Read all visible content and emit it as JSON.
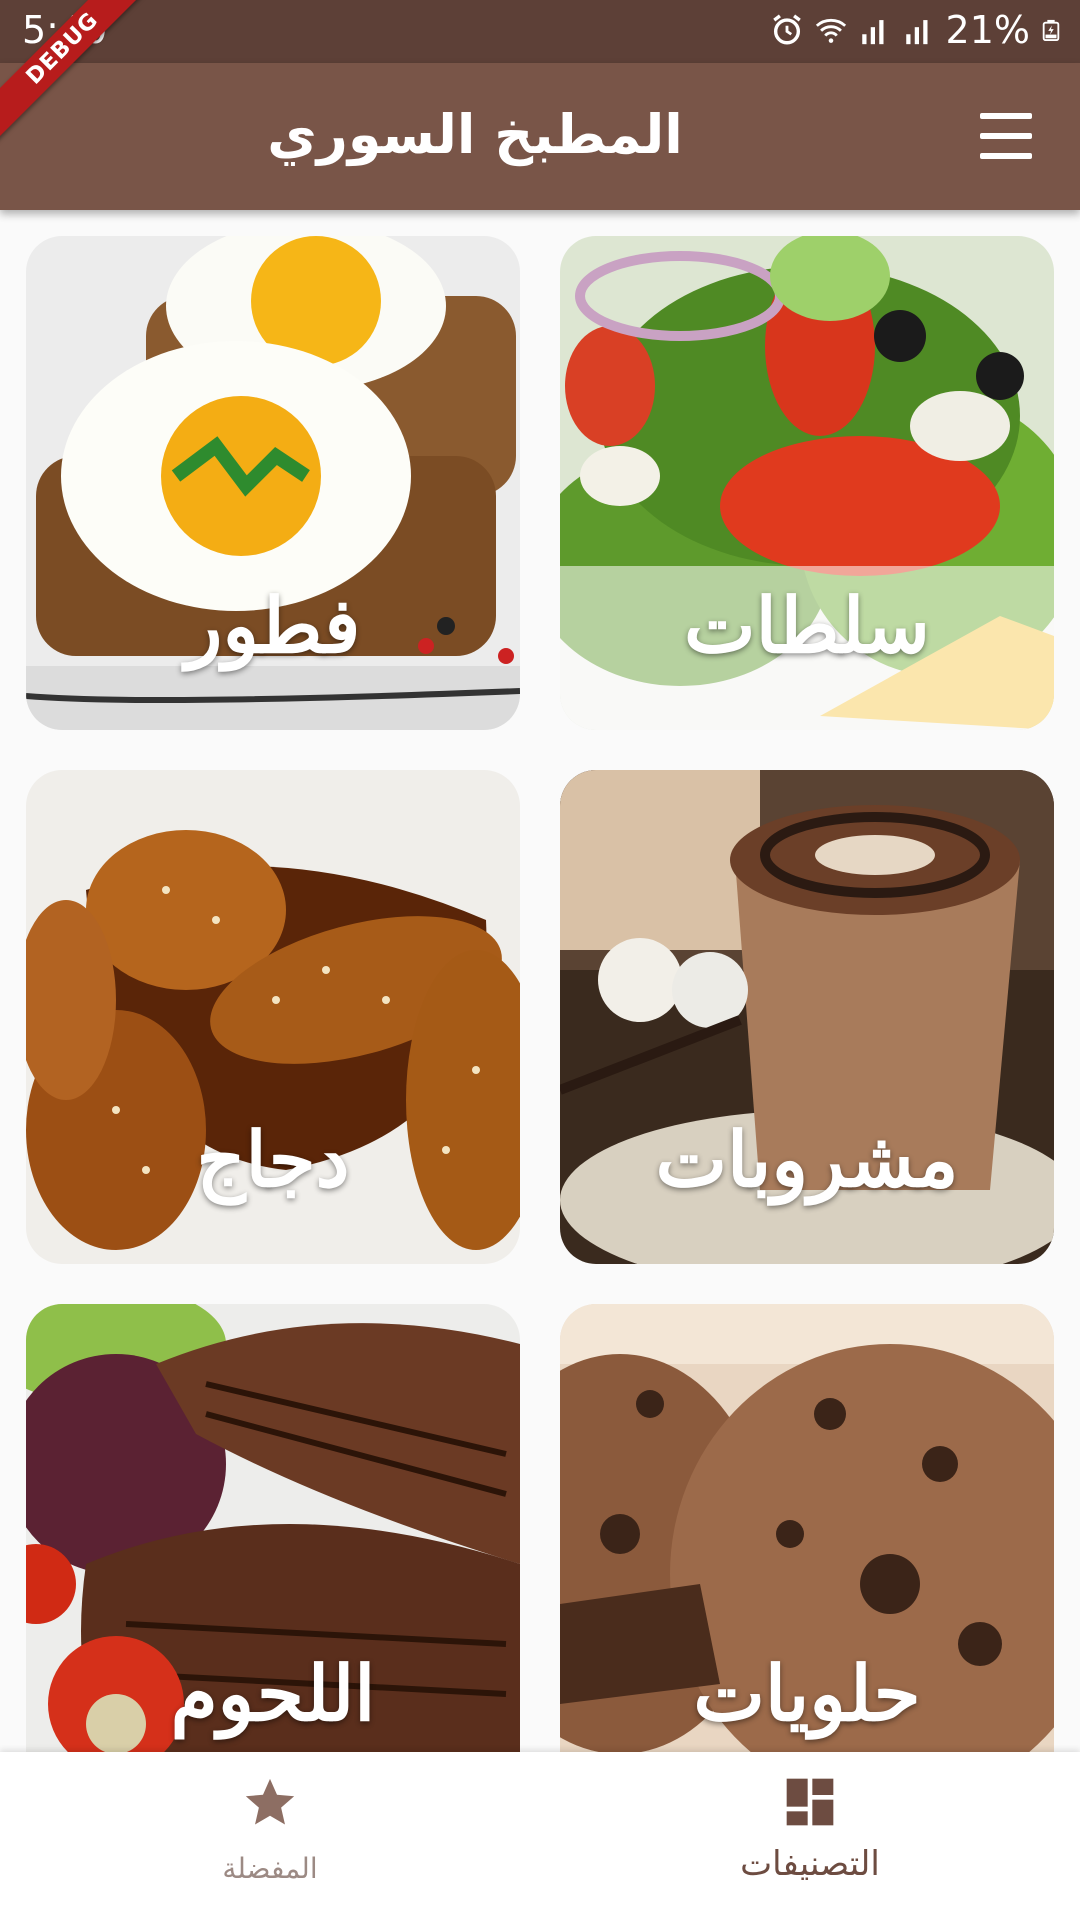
{
  "status_bar": {
    "time": "5:40",
    "battery": "21%",
    "icons": [
      "alarm-icon",
      "wifi-icon",
      "signal-icon",
      "signal-icon",
      "battery-icon"
    ]
  },
  "debug_banner": "DEBUG",
  "app_bar": {
    "title": "المطبخ السوري",
    "menu_icon": "menu-icon"
  },
  "categories": [
    {
      "label": "سلطات"
    },
    {
      "label": "فطور"
    },
    {
      "label": "مشروبات"
    },
    {
      "label": "دجاج"
    },
    {
      "label": "حلويات"
    },
    {
      "label": "اللحوم"
    }
  ],
  "bottom_nav": {
    "items": [
      {
        "label": "المفضلة",
        "icon": "star-icon",
        "active": false
      },
      {
        "label": "التصنيفات",
        "icon": "dashboard-icon",
        "active": true
      }
    ]
  },
  "colors": {
    "status_bar": "#5d4037",
    "app_bar": "#795548",
    "active_nav": "#6d4c41",
    "inactive_nav": "#9c8a84"
  }
}
